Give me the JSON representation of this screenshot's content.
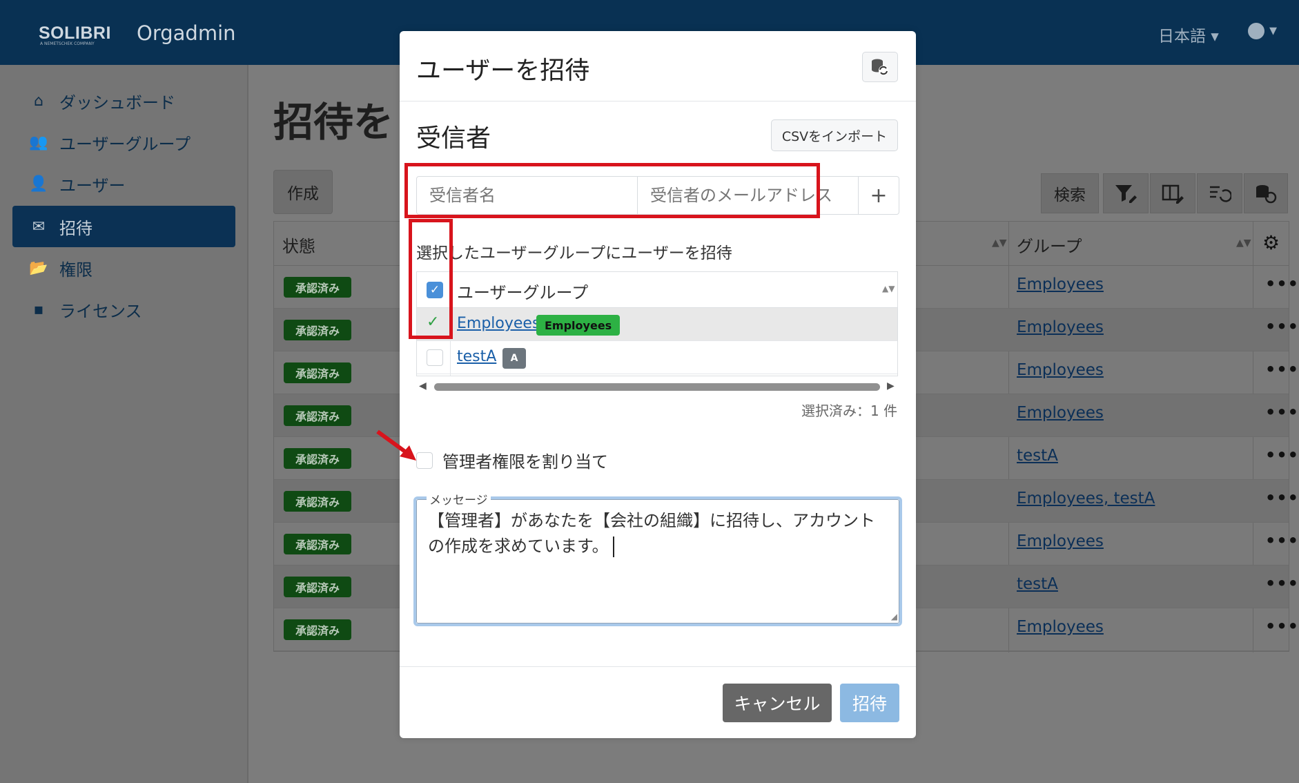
{
  "topbar": {
    "brand": "SOLIBRI",
    "brand_sub": "A NEMETSCHEK COMPANY",
    "app_name": "Orgadmin",
    "language": "日本語 ▾",
    "user_caret": "▾"
  },
  "sidebar": {
    "items": [
      {
        "label": "ダッシュボード",
        "icon": "home-icon",
        "glyph": "⌂"
      },
      {
        "label": "ユーザーグループ",
        "icon": "users-icon",
        "glyph": "👥"
      },
      {
        "label": "ユーザー",
        "icon": "user-icon",
        "glyph": "👤"
      },
      {
        "label": "招待",
        "icon": "envelope-icon",
        "glyph": "✉"
      },
      {
        "label": "権限",
        "icon": "folder-icon",
        "glyph": "📂"
      },
      {
        "label": "ライセンス",
        "icon": "cubes-icon",
        "glyph": "▪"
      }
    ]
  },
  "background": {
    "page_title": "招待を",
    "create_button": "作成",
    "search_button": "検索",
    "table": {
      "col_status": "状態",
      "col_group": "グループ",
      "sort_glyph": "▲▼",
      "gear_glyph": "⚙",
      "dots": "•••",
      "rows": [
        {
          "status": "承認済み",
          "group": "Employees"
        },
        {
          "status": "承認済み",
          "group": "Employees"
        },
        {
          "status": "承認済み",
          "group": "Employees"
        },
        {
          "status": "承認済み",
          "group": "Employees"
        },
        {
          "status": "承認済み",
          "group": "testA"
        },
        {
          "status": "承認済み",
          "group": "Employees, testA"
        },
        {
          "status": "承認済み",
          "group": "Employees"
        },
        {
          "status": "承認済み",
          "group": "testA"
        },
        {
          "status": "承認済み",
          "group": "Employees"
        }
      ]
    }
  },
  "modal": {
    "title": "ユーザーを招待",
    "recipients_title": "受信者",
    "csv_import": "CSVをインポート",
    "name_placeholder": "受信者名",
    "email_placeholder": "受信者のメールアドレス",
    "add_glyph": "+",
    "invite_to_group_label": "選択したユーザーグループにユーザーを招待",
    "grid": {
      "header": "ユーザーグループ",
      "header_check": "✓",
      "sort_glyph": "▲▼",
      "row_check": "✓",
      "rows": [
        {
          "name": "Employees",
          "tag": "Employees",
          "selected": true
        },
        {
          "name": "testA",
          "tag": "A",
          "selected": false
        }
      ]
    },
    "scroll_left": "◀",
    "scroll_right": "▶",
    "selected_count": "選択済み：1 件",
    "admin_label": "管理者権限を割り当て",
    "message_label": "メッセージ",
    "message_text": "【管理者】があなたを【会社の組織】に招待し、アカウントの作成を求めています。",
    "resize_glyph": "◢",
    "cancel_button": "キャンセル",
    "invite_button": "招待"
  },
  "colors": {
    "topbar": "#093153",
    "annotation_red": "#d8141c",
    "tag_green": "#2db144",
    "primary_disabled": "#8cb9e2"
  }
}
